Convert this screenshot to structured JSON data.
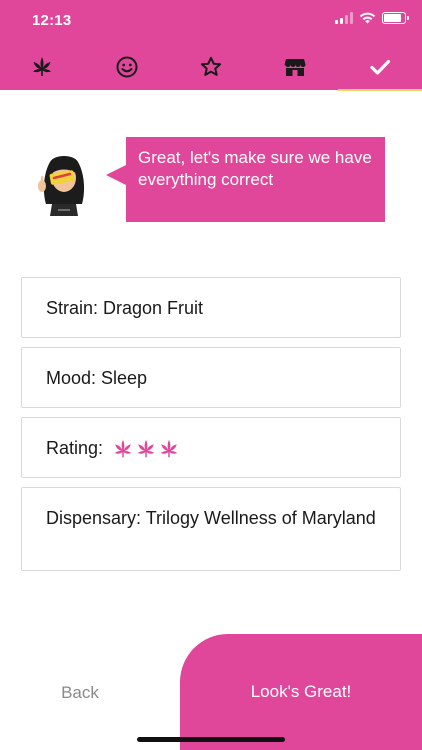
{
  "status_bar": {
    "time": "12:13"
  },
  "tabs": [
    {
      "icon": "cannabis-leaf-icon",
      "active": false
    },
    {
      "icon": "smiley-icon",
      "active": false
    },
    {
      "icon": "star-icon",
      "active": false
    },
    {
      "icon": "storefront-icon",
      "active": false
    },
    {
      "icon": "checkmark-icon",
      "active": true
    }
  ],
  "assistant": {
    "avatar": "noted-avatar",
    "message": "Great, let's make sure we have everything correct"
  },
  "summary": {
    "strain": "Strain: Dragon Fruit",
    "mood": "Mood: Sleep",
    "rating_label": "Rating:",
    "rating_value": 3,
    "rating_icon": "cannabis-leaf-icon",
    "dispensary": "Dispensary: Trilogy Wellness of Maryland"
  },
  "footer": {
    "back_label": "Back",
    "confirm_label": "Look's Great!"
  },
  "colors": {
    "brand_pink": "#e0479a",
    "tab_indicator": "#f5d36a"
  }
}
